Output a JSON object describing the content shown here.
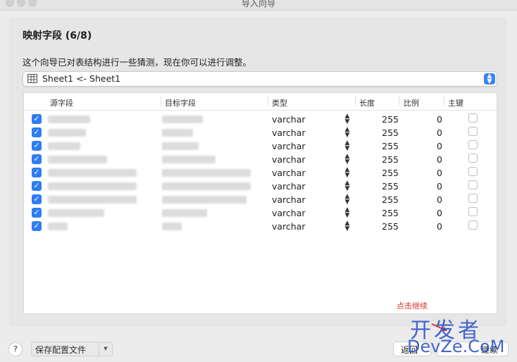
{
  "window": {
    "title": "导入向导"
  },
  "heading": "映射字段 (6/8)",
  "description": "这个向导已对表结构进行一些猜测，现在你可以进行调整。",
  "sheet_select": {
    "value": "Sheet1 <- Sheet1"
  },
  "table": {
    "columns": [
      "源字段",
      "目标字段",
      "类型",
      "长度",
      "比例",
      "主键"
    ],
    "rows": [
      {
        "type": "varchar",
        "length": "255",
        "scale": "0"
      },
      {
        "type": "varchar",
        "length": "255",
        "scale": "0"
      },
      {
        "type": "varchar",
        "length": "255",
        "scale": "0"
      },
      {
        "type": "varchar",
        "length": "255",
        "scale": "0"
      },
      {
        "type": "varchar",
        "length": "255",
        "scale": "0"
      },
      {
        "type": "varchar",
        "length": "255",
        "scale": "0"
      },
      {
        "type": "varchar",
        "length": "255",
        "scale": "0"
      },
      {
        "type": "varchar",
        "length": "255",
        "scale": "0"
      },
      {
        "type": "varchar",
        "length": "255",
        "scale": "0"
      }
    ]
  },
  "annotation": "点击继续",
  "footer": {
    "help": "?",
    "save_profile": "保存配置文件",
    "back": "返回",
    "next": "继续"
  },
  "watermark": {
    "line1": "开发者",
    "line2": "DevZe.CoM"
  },
  "colors": {
    "accent": "#2e7cf6",
    "annotation": "#e0352b",
    "watermark": "#2f56c9"
  }
}
